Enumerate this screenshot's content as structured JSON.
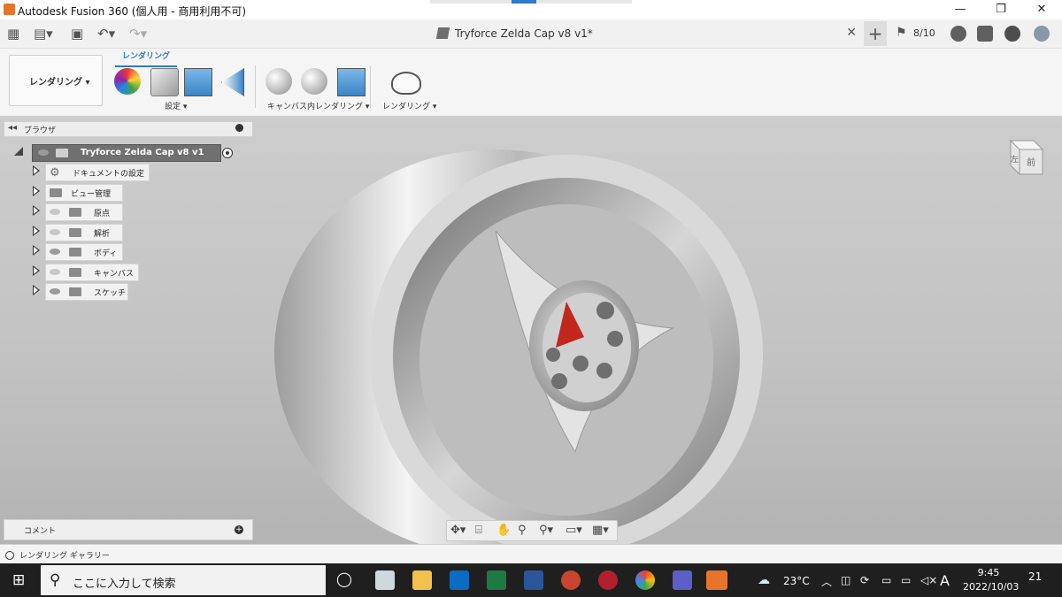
{
  "window": {
    "title": "Autodesk Fusion 360 (個人用 - 商用利用不可)",
    "min": "—",
    "max": "❐",
    "close": "✕"
  },
  "qbar": {
    "doc_title": "Tryforce Zelda Cap v8 v1*",
    "close_tab": "✕",
    "new_tab": "+",
    "jobs": "8/10"
  },
  "toolbar": {
    "workspace": "レンダリング ▾",
    "active_tab": "レンダリング",
    "groups": [
      {
        "label": "設定 ▾"
      },
      {
        "label": "キャンバス内レンダリング ▾"
      },
      {
        "label": "レンダリング ▾"
      }
    ]
  },
  "browser": {
    "title": "ブラウザ",
    "root": "Tryforce Zelda Cap v8 v1",
    "items": [
      {
        "label": "ドキュメントの設定"
      },
      {
        "label": "ビュー管理"
      },
      {
        "label": "原点"
      },
      {
        "label": "解析"
      },
      {
        "label": "ボディ"
      },
      {
        "label": "キャンバス"
      },
      {
        "label": "スケッチ"
      }
    ]
  },
  "viewcube": {
    "front": "前",
    "left": "左"
  },
  "comments": {
    "label": "コメント"
  },
  "gallery": {
    "label": "レンダリング ギャラリー"
  },
  "taskbar": {
    "search_placeholder": "ここに入力して検索",
    "temperature": "23°C",
    "ime": "A",
    "time": "9:45",
    "date": "2022/10/03",
    "notifications": "21"
  },
  "colors": {
    "accent": "#2e7bc6",
    "fusion_orange": "#e8742c",
    "taskbar": "#1f1f1f"
  }
}
